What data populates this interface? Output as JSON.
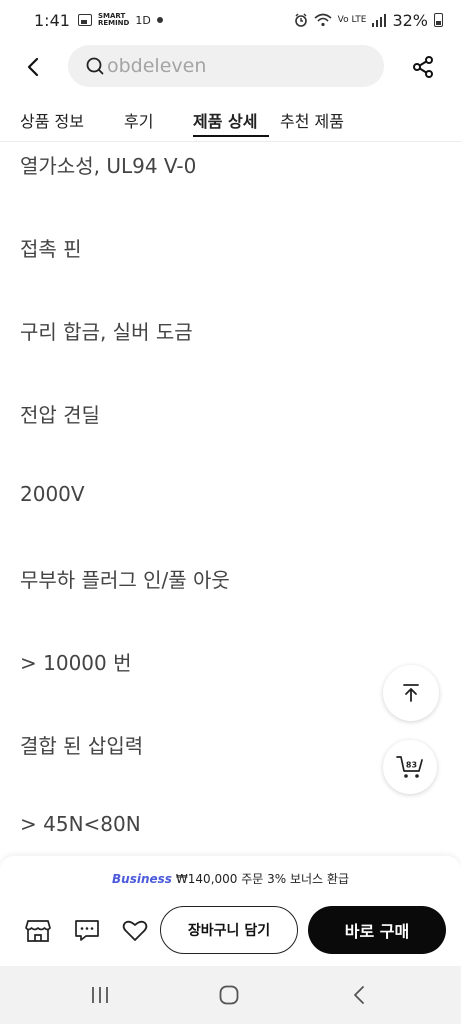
{
  "status_bar": {
    "time": "1:41",
    "smart_label_line1": "SMART",
    "smart_label_line2": "REMIND",
    "notif_label": "1D",
    "net_label": "Vo LTE",
    "battery": "32%"
  },
  "search": {
    "value": "",
    "placeholder": "obdeleven"
  },
  "icons": {
    "back": "chevron-left-icon",
    "search": "search-icon",
    "share": "share-icon",
    "scroll_top": "arrow-up-icon",
    "cart": "cart-icon",
    "store": "store-icon",
    "chat": "chat-icon",
    "wishlist": "heart-icon"
  },
  "tabs": [
    {
      "label": "상품 정보",
      "active": false
    },
    {
      "label": "후기",
      "active": false
    },
    {
      "label": "제품 상세",
      "active": true
    },
    {
      "label": "추천 제품",
      "active": false
    }
  ],
  "details": [
    "열가소성, UL94 V-0",
    "접촉 핀",
    "구리 합금, 실버 도금",
    "전압 견딜",
    "2000V",
    "무부하 플러그 인/풀 아웃",
    "> 10000 번",
    "결합 된 삽입력",
    "> 45N<80N"
  ],
  "cart_count": "83",
  "promo": {
    "brand": "Business",
    "text": "₩140,000 주문 3% 보너스 환급"
  },
  "actions": {
    "add_to_cart": "장바구니 담기",
    "buy_now": "바로 구매"
  },
  "colors": {
    "accent": "#4b5bdc",
    "primary_button": "#0a0a0a",
    "search_bg": "#f0f0f0"
  }
}
